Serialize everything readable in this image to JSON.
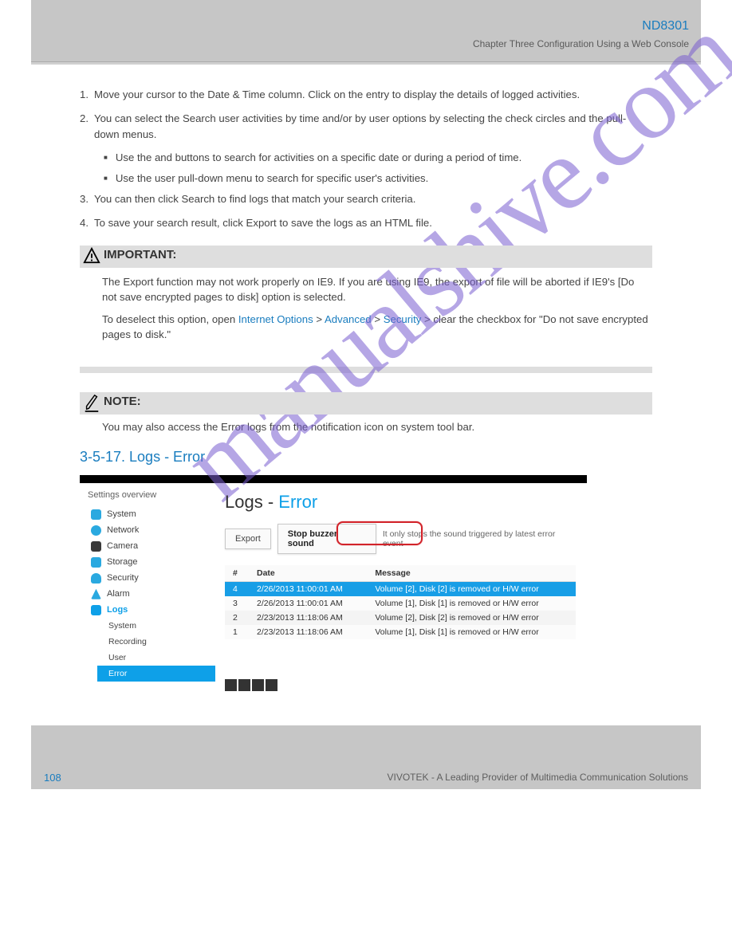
{
  "header": {
    "title_link": "ND8301",
    "subtitle": "Chapter Three Configuration Using a Web Console"
  },
  "steps": [
    {
      "n": "1.",
      "t": "Move your cursor to the Date & Time column. Click on the entry to display the details of logged activities."
    },
    {
      "n": "2.",
      "t": "You can select the Search user activities by time and/or by user options by selecting the check circles and the pull-down menus."
    },
    {
      "sub": "Use the and buttons to search for activities on a specific date or during a period of time."
    },
    {
      "sub": "Use the user pull-down menu to search for specific user's activities."
    },
    {
      "n": "3.",
      "t": "You can then click Search to find logs that match your search criteria."
    },
    {
      "n": "4.",
      "t": "To save your search result, click Export to save the logs as an HTML file."
    }
  ],
  "warn": {
    "title": "IMPORTANT:",
    "p1": "The Export function may not work properly on IE9. If you are using IE9, the export of file will be aborted if IE9's [Do not save encrypted pages to disk] option is selected.",
    "p2_a": "To deselect this option, open ",
    "p2_b": "Internet Options",
    "p2_c": " > ",
    "p2_d": "Advanced",
    "p2_e": " > ",
    "p2_f": "Security",
    "p2_g": " > clear the checkbox for \"Do not save encrypted pages to disk.\""
  },
  "note": {
    "title": "NOTE:",
    "text": "You may also access the Error logs from the notification icon on system tool bar."
  },
  "error_heading": "3-5-17. Logs - Error",
  "shot": {
    "overview": "Settings overview",
    "sidebar": [
      "System",
      "Network",
      "Camera",
      "Storage",
      "Security",
      "Alarm",
      "Logs"
    ],
    "sub": [
      "System",
      "Recording",
      "User",
      "Error"
    ],
    "page_title_a": "Logs",
    "page_title_sep": " - ",
    "page_title_b": "Error",
    "export": "Export",
    "stop": "Stop buzzer sound",
    "hint": "It only stops the sound triggered by latest error event",
    "cols": [
      "#",
      "Date",
      "Message"
    ],
    "rows": [
      {
        "n": "4",
        "d": "2/26/2013 11:00:01 AM",
        "m": "Volume [2], Disk [2] is removed or H/W error",
        "sel": true
      },
      {
        "n": "3",
        "d": "2/26/2013 11:00:01 AM",
        "m": "Volume [1], Disk [1] is removed or H/W error"
      },
      {
        "n": "2",
        "d": "2/23/2013 11:18:06 AM",
        "m": "Volume [2], Disk [2] is removed or H/W error"
      },
      {
        "n": "1",
        "d": "2/23/2013 11:18:06 AM",
        "m": "Volume [1], Disk [1] is removed or H/W error"
      }
    ]
  },
  "footer": {
    "page": "108",
    "owner": "VIVOTEK - A Leading Provider of Multimedia Communication Solutions"
  },
  "watermark": "manualshive.com"
}
